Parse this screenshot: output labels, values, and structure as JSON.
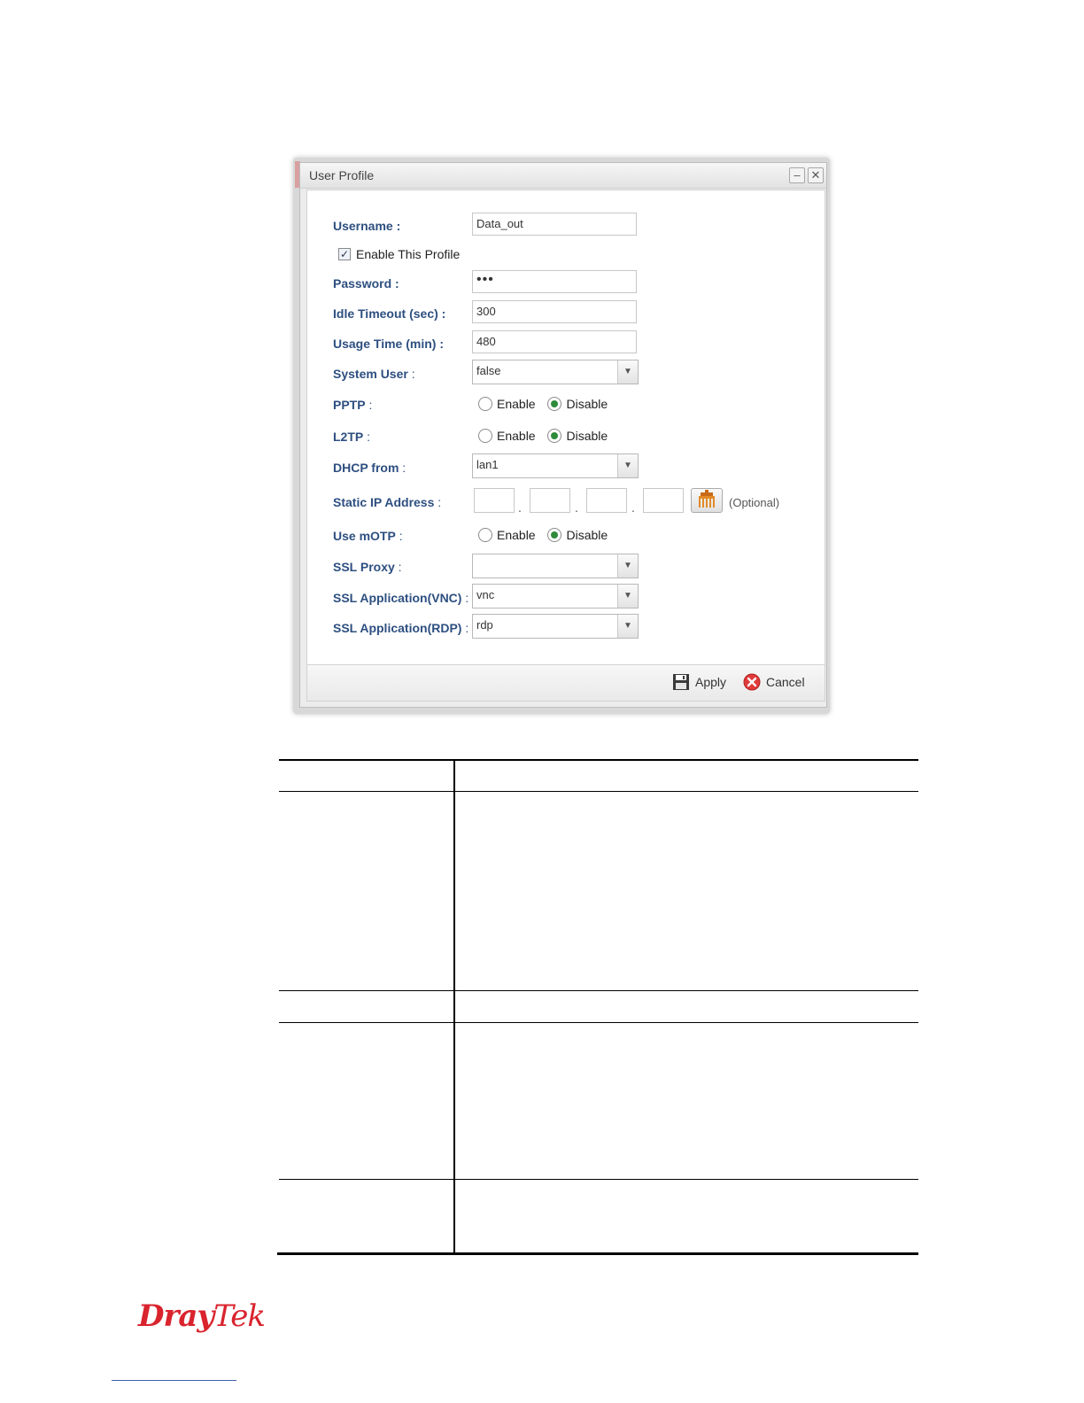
{
  "dialog": {
    "title": "User Profile",
    "minimize_glyph": "–",
    "close_glyph": "✕",
    "fields": {
      "username": {
        "label": "Username :",
        "value": "Data_out"
      },
      "enable_profile": {
        "label": "Enable This Profile",
        "checked": true
      },
      "password": {
        "label": "Password :",
        "value": "•••"
      },
      "idle_timeout": {
        "label": "Idle Timeout (sec) :",
        "value": "300"
      },
      "usage_time": {
        "label": "Usage Time (min) :",
        "value": "480"
      },
      "system_user": {
        "label_main": "System User",
        "label_colon": " :",
        "value": "false"
      },
      "pptp": {
        "label_main": "PPTP",
        "label_colon": " :",
        "enable": "Enable",
        "disable": "Disable",
        "selected": "Disable"
      },
      "l2tp": {
        "label_main": "L2TP",
        "label_colon": " :",
        "enable": "Enable",
        "disable": "Disable",
        "selected": "Disable"
      },
      "dhcp_from": {
        "label_main": "DHCP from",
        "label_colon": " :",
        "value": "lan1"
      },
      "static_ip": {
        "label_main": "Static IP Address",
        "label_colon": " :",
        "optional": "(Optional)",
        "octets": [
          "",
          "",
          "",
          ""
        ],
        "dot": "."
      },
      "use_motp": {
        "label_main": "Use mOTP",
        "label_colon": " :",
        "enable": "Enable",
        "disable": "Disable",
        "selected": "Disable"
      },
      "ssl_proxy": {
        "label_main": "SSL Proxy",
        "label_colon": " :",
        "value": ""
      },
      "ssl_app_vnc": {
        "label_main": "SSL Application(VNC)",
        "label_colon": " :",
        "value": "vnc"
      },
      "ssl_app_rdp": {
        "label_main": "SSL Application(RDP)",
        "label_colon": " :",
        "value": "rdp"
      }
    },
    "footer": {
      "apply": "Apply",
      "cancel": "Cancel",
      "apply_icon": "save-icon",
      "cancel_icon": "cancel-icon"
    }
  },
  "logo": {
    "part1": "Dray",
    "part2": "Tek",
    "color": "#d9232d"
  },
  "colors": {
    "label": "#2d4f80",
    "radio_selected": "#2e8b3a"
  }
}
